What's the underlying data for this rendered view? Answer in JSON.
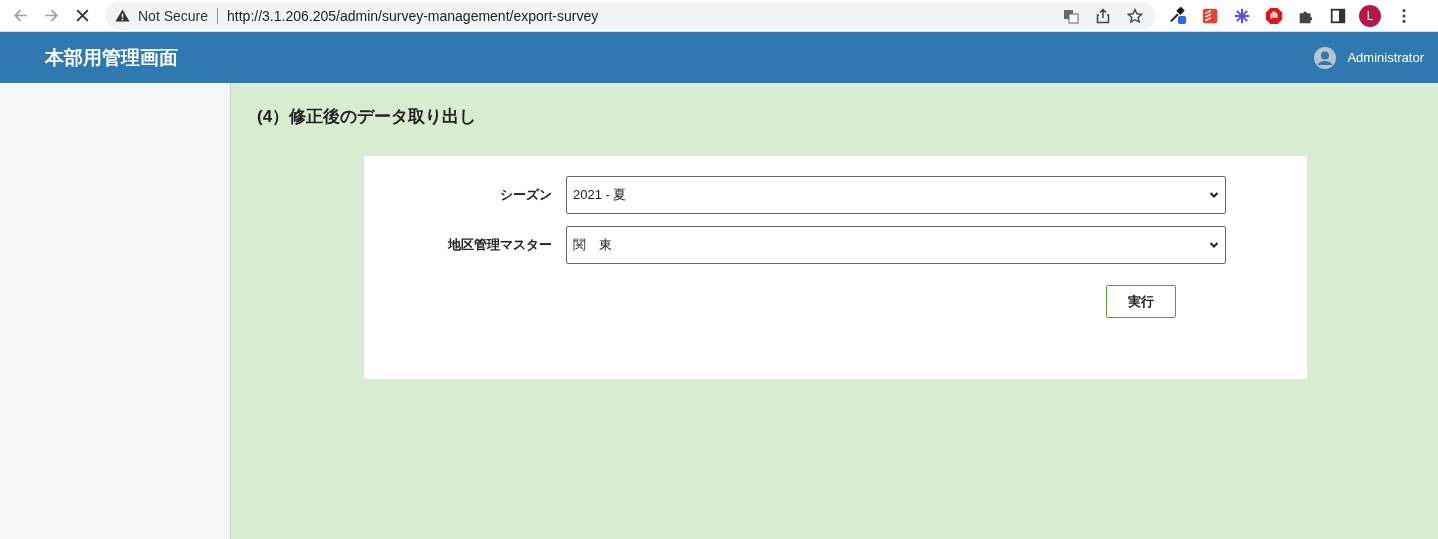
{
  "browser": {
    "security_label": "Not Secure",
    "url": "http://3.1.206.205/admin/survey-management/export-survey",
    "profile_initial": "L"
  },
  "header": {
    "title": "本部用管理画面",
    "user": "Administrator"
  },
  "page": {
    "heading": "(4）修正後のデータ取り出し",
    "fields": [
      {
        "label": "シーズン",
        "value": "2021 - 夏"
      },
      {
        "label": "地区管理マスター",
        "value": "関　東"
      }
    ],
    "submit": "実行"
  }
}
